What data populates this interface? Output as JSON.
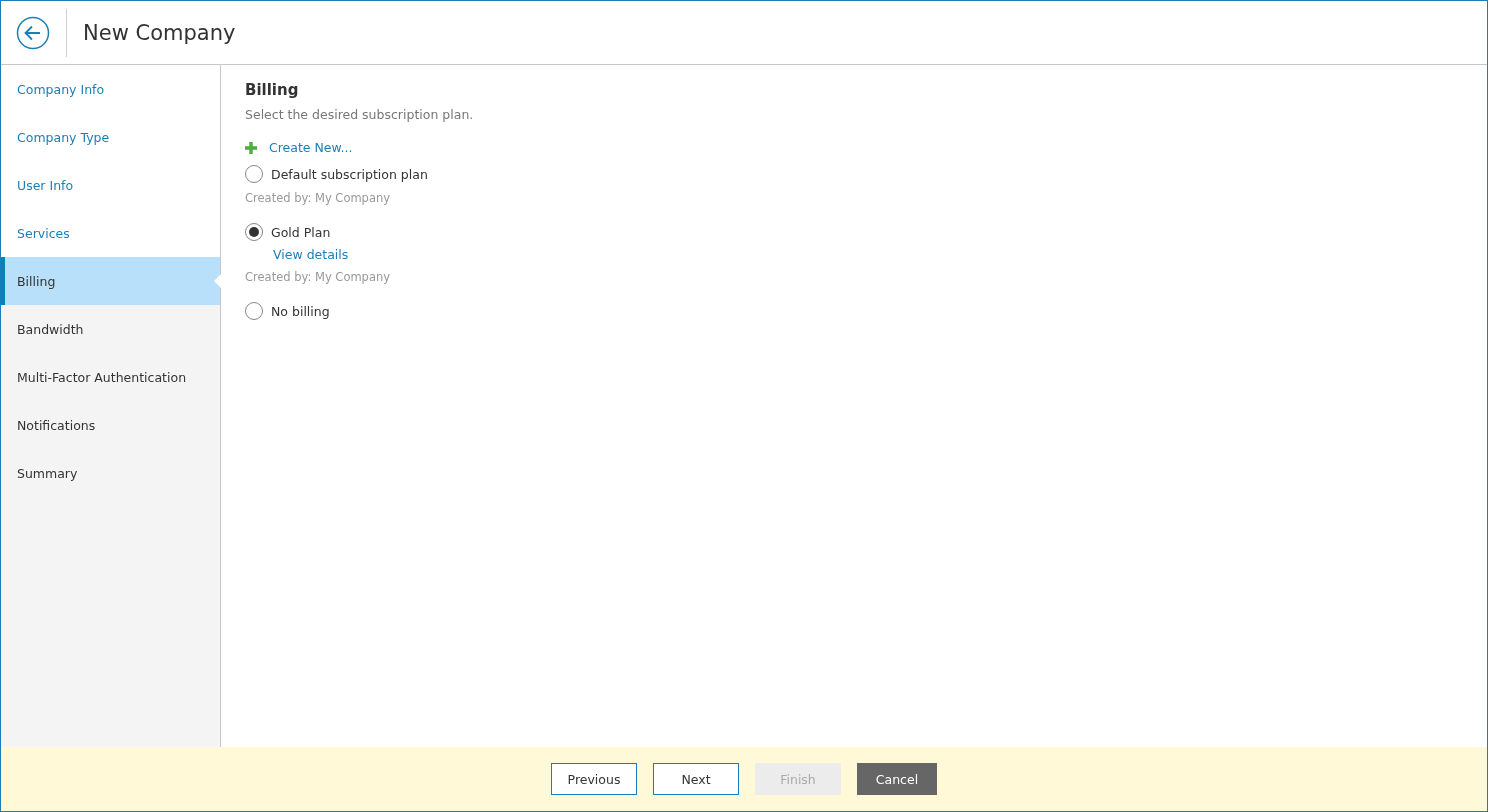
{
  "window": {
    "title": "New Company"
  },
  "sidebar": {
    "items": [
      {
        "label": "Company Info",
        "completed": true,
        "selected": false
      },
      {
        "label": "Company Type",
        "completed": true,
        "selected": false
      },
      {
        "label": "User Info",
        "completed": true,
        "selected": false
      },
      {
        "label": "Services",
        "completed": true,
        "selected": false
      },
      {
        "label": "Billing",
        "completed": false,
        "selected": true
      },
      {
        "label": "Bandwidth",
        "completed": false,
        "selected": false
      },
      {
        "label": "Multi-Factor Authentication",
        "completed": false,
        "selected": false
      },
      {
        "label": "Notifications",
        "completed": false,
        "selected": false
      },
      {
        "label": "Summary",
        "completed": false,
        "selected": false
      }
    ]
  },
  "content": {
    "heading": "Billing",
    "description": "Select the desired subscription plan.",
    "create_link": "Create New...",
    "plans": [
      {
        "name": "Default subscription plan",
        "selected": false,
        "created_by": "Created by: My Company"
      },
      {
        "name": "Gold Plan",
        "selected": true,
        "link": "View details",
        "created_by": "Created by: My Company"
      },
      {
        "name": "No billing",
        "selected": false
      }
    ]
  },
  "footer": {
    "buttons": [
      {
        "label": "Previous",
        "kind": "outline",
        "disabled": false
      },
      {
        "label": "Next",
        "kind": "outline",
        "disabled": false
      },
      {
        "label": "Finish",
        "kind": "outline",
        "disabled": true
      },
      {
        "label": "Cancel",
        "kind": "dark",
        "disabled": false
      }
    ]
  }
}
